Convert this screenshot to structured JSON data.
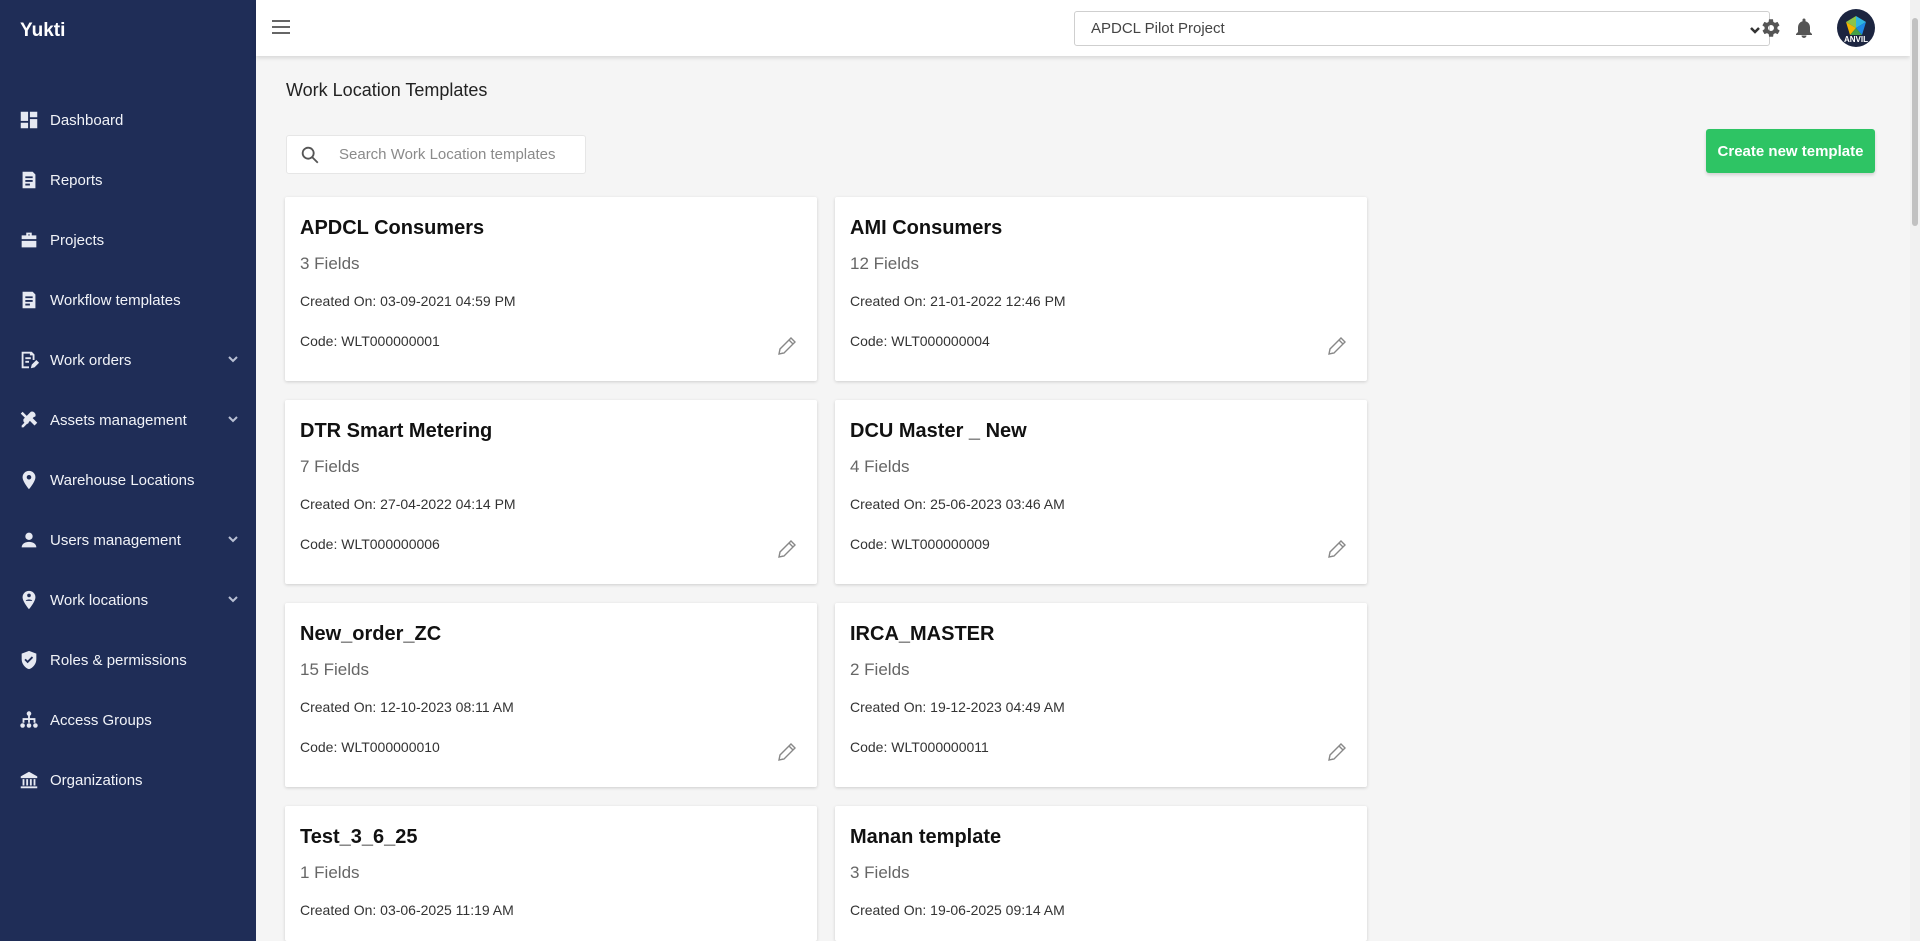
{
  "app": {
    "brand": "Yukti"
  },
  "sidebar": {
    "items": [
      {
        "label": "Dashboard",
        "icon": "dashboard-icon",
        "expandable": false
      },
      {
        "label": "Reports",
        "icon": "report-icon",
        "expandable": false
      },
      {
        "label": "Projects",
        "icon": "briefcase-icon",
        "expandable": false
      },
      {
        "label": "Workflow templates",
        "icon": "document-icon",
        "expandable": false
      },
      {
        "label": "Work orders",
        "icon": "work-order-icon",
        "expandable": true
      },
      {
        "label": "Assets management",
        "icon": "tools-icon",
        "expandable": true
      },
      {
        "label": "Warehouse Locations",
        "icon": "location-pin-icon",
        "expandable": false
      },
      {
        "label": "Users management",
        "icon": "user-icon",
        "expandable": true
      },
      {
        "label": "Work locations",
        "icon": "location-person-icon",
        "expandable": true
      },
      {
        "label": "Roles & permissions",
        "icon": "shield-check-icon",
        "expandable": false
      },
      {
        "label": "Access Groups",
        "icon": "hierarchy-icon",
        "expandable": false
      },
      {
        "label": "Organizations",
        "icon": "building-icon",
        "expandable": false
      }
    ]
  },
  "topbar": {
    "project_selected": "APDCL Pilot Project",
    "avatar_text": "ANVIL"
  },
  "main": {
    "title": "Work Location Templates",
    "search": {
      "placeholder": "Search Work Location templates",
      "value": ""
    },
    "create_button": "Create new template",
    "cards": [
      {
        "title": "APDCL Consumers",
        "fields": "3 Fields",
        "created": "Created On: 03-09-2021 04:59 PM",
        "code": "Code: WLT000000001"
      },
      {
        "title": "AMI Consumers",
        "fields": "12 Fields",
        "created": "Created On: 21-01-2022 12:46 PM",
        "code": "Code: WLT000000004"
      },
      {
        "title": "DTR Smart Metering",
        "fields": "7 Fields",
        "created": "Created On: 27-04-2022 04:14 PM",
        "code": "Code: WLT000000006"
      },
      {
        "title": "DCU Master _ New",
        "fields": "4 Fields",
        "created": "Created On: 25-06-2023 03:46 AM",
        "code": "Code: WLT000000009"
      },
      {
        "title": "New_order_ZC",
        "fields": "15 Fields",
        "created": "Created On: 12-10-2023 08:11 AM",
        "code": "Code: WLT000000010"
      },
      {
        "title": "IRCA_MASTER",
        "fields": "2 Fields",
        "created": "Created On: 19-12-2023 04:49 AM",
        "code": "Code: WLT000000011"
      },
      {
        "title": "Test_3_6_25",
        "fields": "1 Fields",
        "created": "Created On: 03-06-2025 11:19 AM",
        "code": ""
      },
      {
        "title": "Manan template",
        "fields": "3 Fields",
        "created": "Created On: 19-06-2025 09:14 AM",
        "code": ""
      }
    ]
  },
  "colors": {
    "sidebar_bg": "#1f2d57",
    "primary_button": "#2ec464",
    "page_bg": "#f5f5f5"
  }
}
